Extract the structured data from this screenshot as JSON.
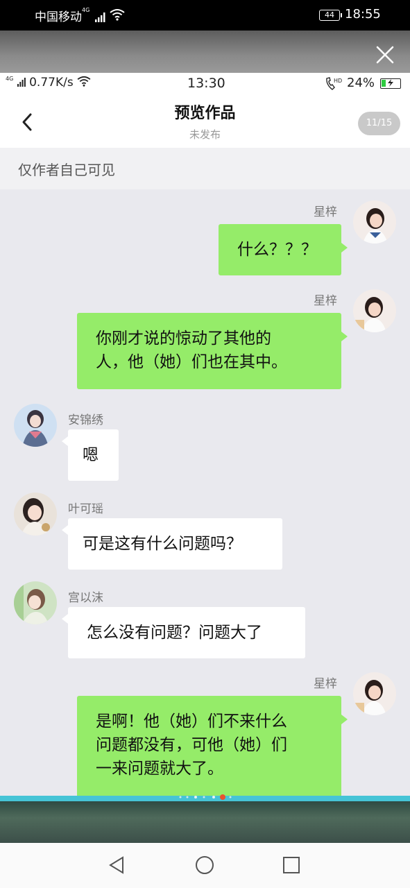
{
  "outer_status": {
    "carrier": "中国移动",
    "network_tag": "4G",
    "battery": "44",
    "time": "18:55"
  },
  "inner_status": {
    "network_tag": "4G",
    "speed": "0.77K/s",
    "time": "13:30",
    "hd": "HD",
    "battery_pct": "24%",
    "battery_level": 0.24
  },
  "header": {
    "title": "预览作品",
    "subtitle": "未发布",
    "page_indicator": "11/15"
  },
  "visibility_note": "仅作者自己可见",
  "messages": [
    {
      "sender": "星梓",
      "side": "right",
      "lines": [
        "什么？？？"
      ]
    },
    {
      "sender": "星梓",
      "side": "right",
      "lines": [
        "你刚才说的惊动了其他的",
        "人，他（她）们也在其中。"
      ]
    },
    {
      "sender": "安锦绣",
      "side": "left",
      "lines": [
        "嗯"
      ]
    },
    {
      "sender": "叶可瑶",
      "side": "left",
      "lines": [
        "可是这有什么问题吗？"
      ]
    },
    {
      "sender": "宫以沫",
      "side": "left",
      "lines": [
        "怎么没有问题？问题大了"
      ]
    },
    {
      "sender": "星梓",
      "side": "right",
      "lines": [
        "是啊！他（她）们不来什么",
        "问题都没有，可他（她）们",
        "一来问题就大了。"
      ]
    }
  ],
  "colors": {
    "my_bubble": "#95ec69",
    "other_bubble": "#ffffff",
    "chat_bg": "#e9e9ee",
    "progress": "#46c4d6",
    "active_dot": "#e8542f"
  }
}
